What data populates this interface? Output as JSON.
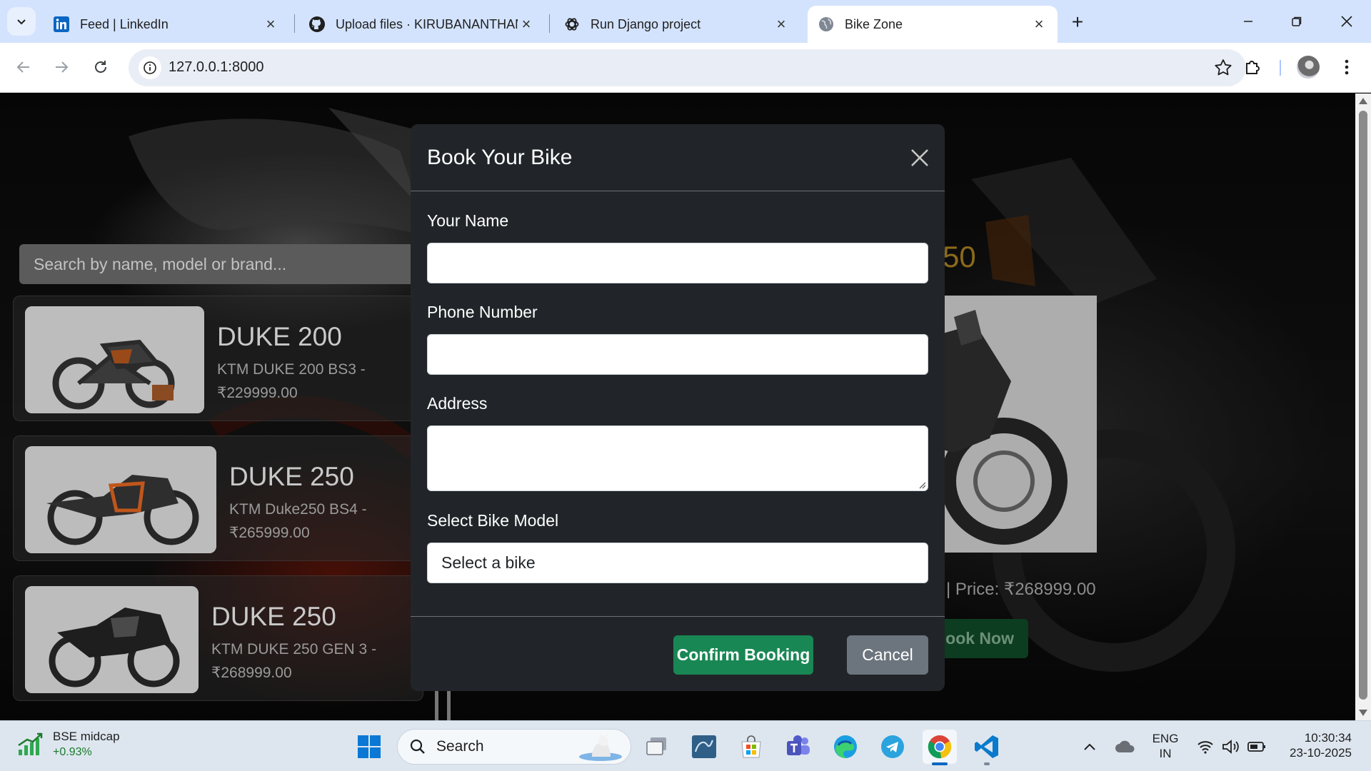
{
  "browser": {
    "tabs": [
      {
        "title": "Feed | LinkedIn",
        "icon": "linkedin-icon"
      },
      {
        "title": "Upload files · KIRUBANANTHAN",
        "icon": "github-icon"
      },
      {
        "title": "Run Django project",
        "icon": "openai-icon"
      },
      {
        "title": "Bike Zone",
        "icon": "globe-icon",
        "active": true
      }
    ],
    "url": "127.0.0.1:8000"
  },
  "page": {
    "search_placeholder": "Search by name, model or brand...",
    "bikes": [
      {
        "name": "DUKE 200",
        "desc": "KTM DUKE 200 BS3 - ₹229999.00"
      },
      {
        "name": "DUKE 250",
        "desc": "KTM Duke250 BS4 - ₹265999.00"
      },
      {
        "name": "DUKE 250",
        "desc": "KTM DUKE 250 GEN 3 - ₹268999.00"
      }
    ],
    "hero": {
      "title_fragment": "50",
      "price_text": "| Price: ₹268999.00",
      "book_button": "ook Now"
    }
  },
  "modal": {
    "title": "Book Your Bike",
    "fields": {
      "name_label": "Your Name",
      "name_value": "",
      "phone_label": "Phone Number",
      "phone_value": "",
      "address_label": "Address",
      "address_value": "",
      "model_label": "Select Bike Model",
      "model_selected": "Select a bike"
    },
    "confirm_button": "Confirm Booking",
    "cancel_button": "Cancel"
  },
  "taskbar": {
    "widget": {
      "title": "BSE midcap",
      "change": "+0.93%"
    },
    "search_label": "Search",
    "language": {
      "line1": "ENG",
      "line2": "IN"
    },
    "time": "10:30:34",
    "date": "23-10-2025"
  },
  "colors": {
    "modal_bg": "#212529",
    "confirm_green": "#198754",
    "cancel_gray": "#6c757d",
    "chrome_tabstrip": "#d3e3fd"
  }
}
